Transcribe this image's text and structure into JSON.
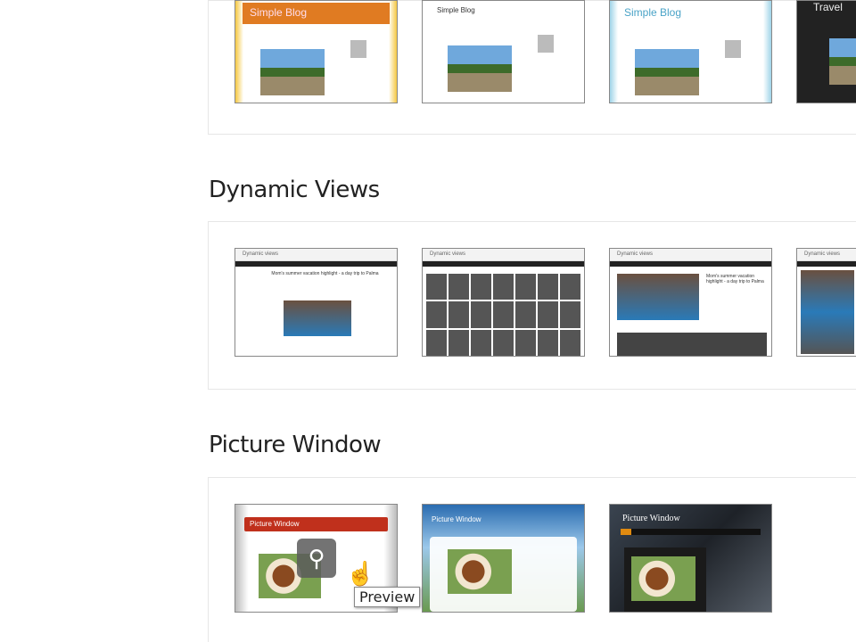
{
  "sections": [
    {
      "title": "Simple",
      "templates": [
        {
          "name": "Simple Blog",
          "variant": "orange"
        },
        {
          "name": "Simple Blog",
          "variant": "white"
        },
        {
          "name": "Simple Blog",
          "variant": "blue"
        },
        {
          "name": "Travel",
          "variant": "dark"
        }
      ]
    },
    {
      "title": "Dynamic Views",
      "templates": [
        {
          "name": "Dynamic views",
          "variant": "classic",
          "post_title": "Mom's summer vacation highlight - a day trip to Palma"
        },
        {
          "name": "Dynamic views",
          "variant": "mosaic"
        },
        {
          "name": "Dynamic views",
          "variant": "magazine",
          "post_title": "Mom's summer vacation highlight - a day trip to Palma"
        },
        {
          "name": "Dynamic views",
          "variant": "flipcard"
        }
      ]
    },
    {
      "title": "Picture Window",
      "templates": [
        {
          "name": "Picture Window",
          "variant": "red"
        },
        {
          "name": "Picture Window",
          "variant": "sky"
        },
        {
          "name": "Picture Window",
          "variant": "dark"
        }
      ]
    }
  ],
  "hover": {
    "icon": "magnifier-icon",
    "tooltip": "Preview"
  }
}
